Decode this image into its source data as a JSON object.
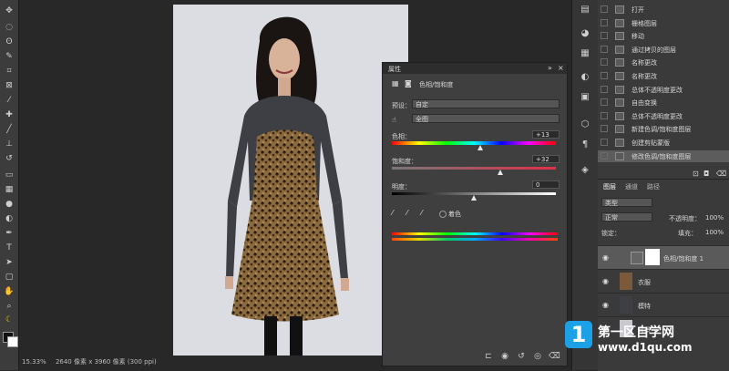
{
  "status": {
    "zoom": "15.33%",
    "doc_info": "2640 像素 x 3960 像素 (300 ppi)"
  },
  "toolbar": {
    "tools": [
      "move-tool",
      "marquee-tool",
      "lasso-tool",
      "quick-select-tool",
      "crop-tool",
      "frame-tool",
      "eyedropper-tool",
      "healing-tool",
      "brush-tool",
      "stamp-tool",
      "history-brush-tool",
      "eraser-tool",
      "gradient-tool",
      "blur-tool",
      "dodge-tool",
      "pen-tool",
      "type-tool",
      "path-select-tool",
      "shape-tool",
      "hand-tool",
      "zoom-tool"
    ]
  },
  "properties": {
    "title": "属性",
    "header_label": "色相/饱和度",
    "preset_label": "预设：",
    "preset_value": "自定",
    "channel_value": "全图",
    "hue_label": "色相：",
    "hue_value": "+13",
    "saturation_label": "饱和度：",
    "saturation_value": "+32",
    "lightness_label": "明度：",
    "lightness_value": "0",
    "colorize_label": "着色",
    "hue_level": 0.54,
    "saturation_level": 0.66,
    "lightness_level": 0.5
  },
  "history": {
    "items": [
      "打开",
      "栅格图层",
      "移动",
      "通过拷贝的图层",
      "名称更改",
      "名称更改",
      "总体不透明度更改",
      "自由变换",
      "总体不透明度更改",
      "新建色调/饱和度图层",
      "创建剪贴蒙版",
      "修改色调/饱和度图层"
    ]
  },
  "layers": {
    "tabs": [
      "图层",
      "通道",
      "路径"
    ],
    "filter_label": "类型",
    "blend_mode": "正常",
    "opacity_label": "不透明度：",
    "opacity_value": "100%",
    "lock_label": "锁定：",
    "fill_label": "填充：",
    "fill_value": "100%",
    "rows": [
      {
        "name": "色相/饱和度 1"
      },
      {
        "name": "衣服"
      },
      {
        "name": "模特"
      },
      {
        "name": "背景"
      }
    ]
  },
  "watermark": {
    "title": "第一区自学网",
    "url": "www.d1qu.com",
    "logo_char": "1"
  }
}
